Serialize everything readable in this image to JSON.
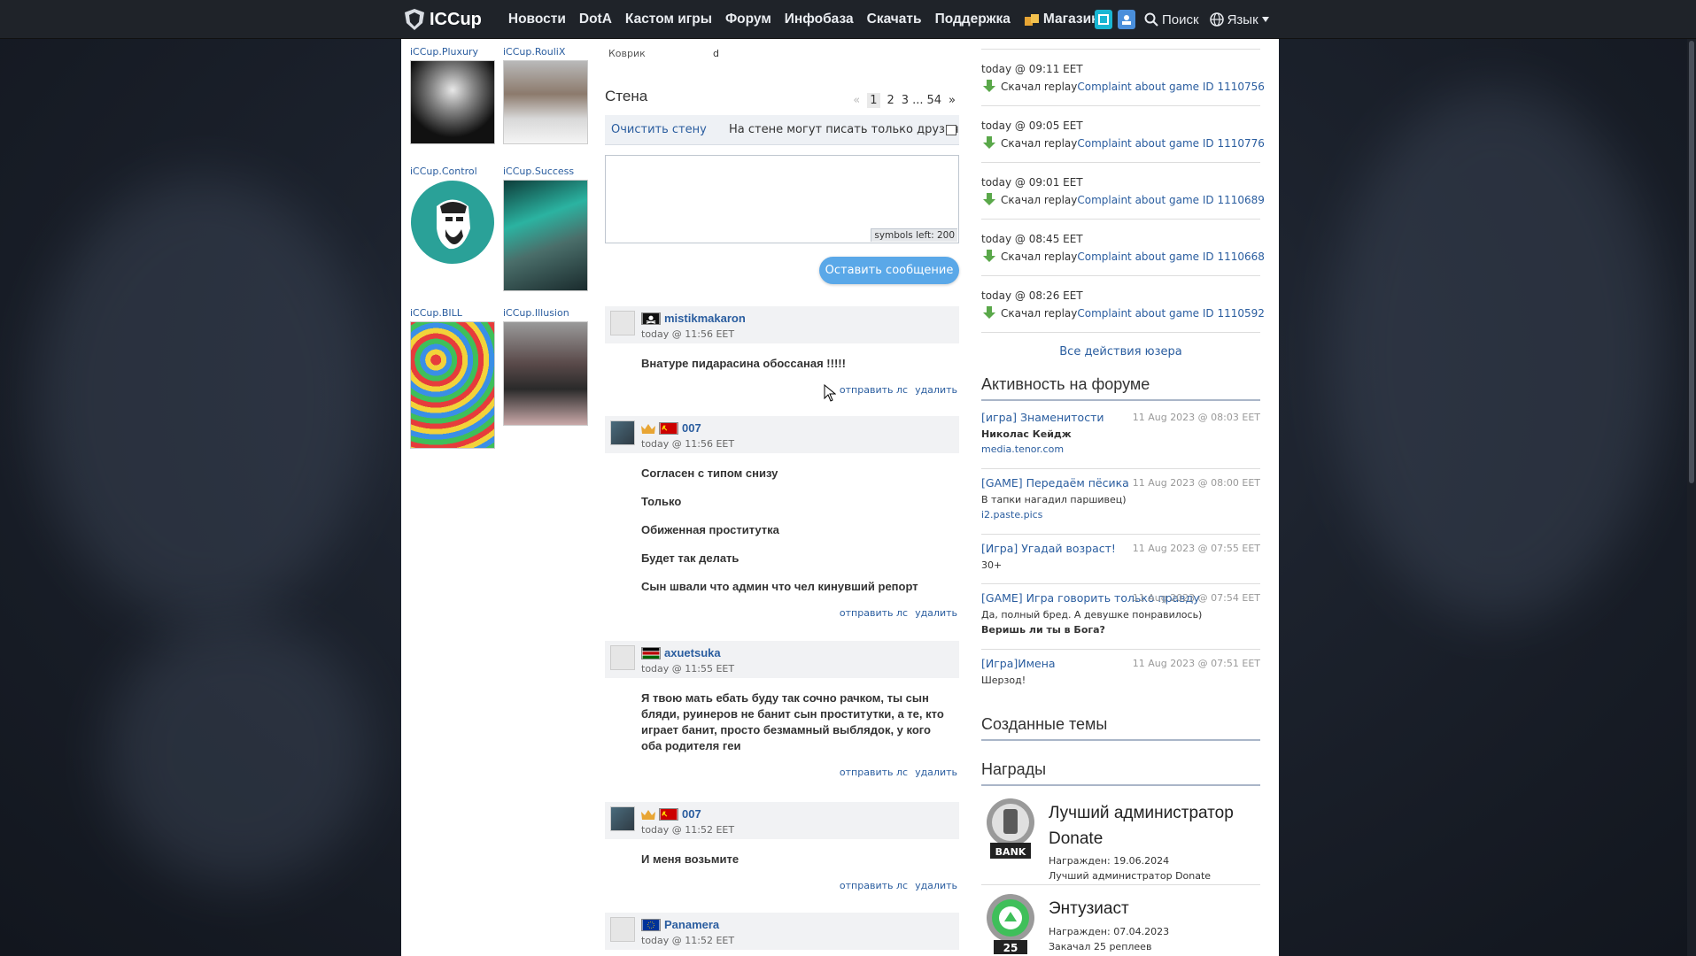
{
  "nav": {
    "logo": "ICCup",
    "items": [
      {
        "label": "Новости",
        "icon": ""
      },
      {
        "label": "DotA",
        "icon": ""
      },
      {
        "label": "Кастом игры",
        "icon": ""
      },
      {
        "label": "Форум",
        "icon": ""
      },
      {
        "label": "Инфобаза",
        "icon": ""
      },
      {
        "label": "Скачать",
        "icon": ""
      },
      {
        "label": "Поддержка",
        "icon": ""
      },
      {
        "label": "Магазин",
        "icon": "shop-icon"
      }
    ],
    "search_label": "Поиск",
    "lang_label": "Язык"
  },
  "friends": [
    {
      "name": "iCCup.Pluxury"
    },
    {
      "name": "iCCup.RouliX"
    },
    {
      "name": "iCCup.Control"
    },
    {
      "name": "iCCup.Success"
    },
    {
      "name": "iCCup.BILL"
    },
    {
      "name": "iCCup.Illusion"
    }
  ],
  "profile": {
    "kovrik_label": "Коврик",
    "kovrik_value": "d"
  },
  "wall": {
    "title": "Стена",
    "pager": {
      "prev": "«",
      "pages": [
        "1",
        "2",
        "3"
      ],
      "ellipsis": "...",
      "last": "54",
      "next": "»"
    },
    "clear_label": "Очистить стену",
    "friends_only_label": "На стене могут писать только друзья",
    "symbols_left": "symbols left: 200",
    "post_button": "Оставить сообщение",
    "send_pm": "отправить лс",
    "delete": "удалить",
    "messages": [
      {
        "user": "mistikmakaron",
        "time": "today @ 11:56 EET",
        "lines": [
          "Внатуре пидарасина обоссаная !!!!!"
        ]
      },
      {
        "user": "007",
        "time": "today @ 11:56 EET",
        "lines": [
          "Согласен с типом снизу",
          "Только",
          "Обиженная проститутка",
          "Будет так делать",
          "Сын швали что админ что чел кинувший репорт"
        ]
      },
      {
        "user": "axuetsuka",
        "time": "today @ 11:55 EET",
        "lines": [
          "Я твою мать ебать буду так сочно рачком, ты сын бляди, руинеров не банит сын проститутки, а те, кто играет банит, просто безмамный выблядок, у кого оба родителя геи"
        ]
      },
      {
        "user": "007",
        "time": "today @ 11:52 EET",
        "lines": [
          "И меня возьмите"
        ]
      },
      {
        "user": "Panamera",
        "time": "today @ 11:52 EET",
        "lines": []
      }
    ]
  },
  "activity": {
    "action": "Скачал",
    "replay_word": "replay",
    "items": [
      {
        "time": "today @ 09:11 EET",
        "link": "Complaint about game ID 1110756"
      },
      {
        "time": "today @ 09:05 EET",
        "link": "Complaint about game ID 1110776"
      },
      {
        "time": "today @ 09:01 EET",
        "link": "Complaint about game ID 1110689"
      },
      {
        "time": "today @ 08:45 EET",
        "link": "Complaint about game ID 1110668"
      },
      {
        "time": "today @ 08:26 EET",
        "link": "Complaint about game ID 1110592"
      }
    ],
    "all_label": "Все действия юзера"
  },
  "forum": {
    "title": "Активность на форуме",
    "topics": [
      {
        "title": "[игра] Знаменитости",
        "date": "11 Aug 2023 @ 08:03 EET",
        "line1": "Николас Кейдж",
        "line2": "media.tenor.com"
      },
      {
        "title": "[GAME] Передаём пёсика",
        "date": "11 Aug 2023 @ 08:00 EET",
        "line1": "В тапки нагадил паршивец)",
        "line2": "i2.paste.pics"
      },
      {
        "title": "[Игра] Угадай возраст!",
        "date": "11 Aug 2023 @ 07:55 EET",
        "line1": "30+",
        "line2": ""
      },
      {
        "title": "[GAME] Игра говорить только правду",
        "date": "11 Aug 2023 @ 07:54 EET",
        "line1": "Да, полный бред. А девушке понравилось)",
        "line2": "Веришь ли ты в Бога?"
      },
      {
        "title": "[Игра]Имена",
        "date": "11 Aug 2023 @ 07:51 EET",
        "line1": "Шерзод!",
        "line2": ""
      }
    ]
  },
  "created_topics_title": "Созданные темы",
  "awards": {
    "title": "Награды",
    "items": [
      {
        "name": "Лучший администратор Donate",
        "date": "Награжден: 19.06.2024",
        "desc": "Лучший администратор Donate",
        "badge_text": "BANK"
      },
      {
        "name": "Энтузиаст",
        "date": "Награжден: 07.04.2023",
        "desc": "Закачал 25 реплеев",
        "badge_text": "25"
      }
    ]
  }
}
